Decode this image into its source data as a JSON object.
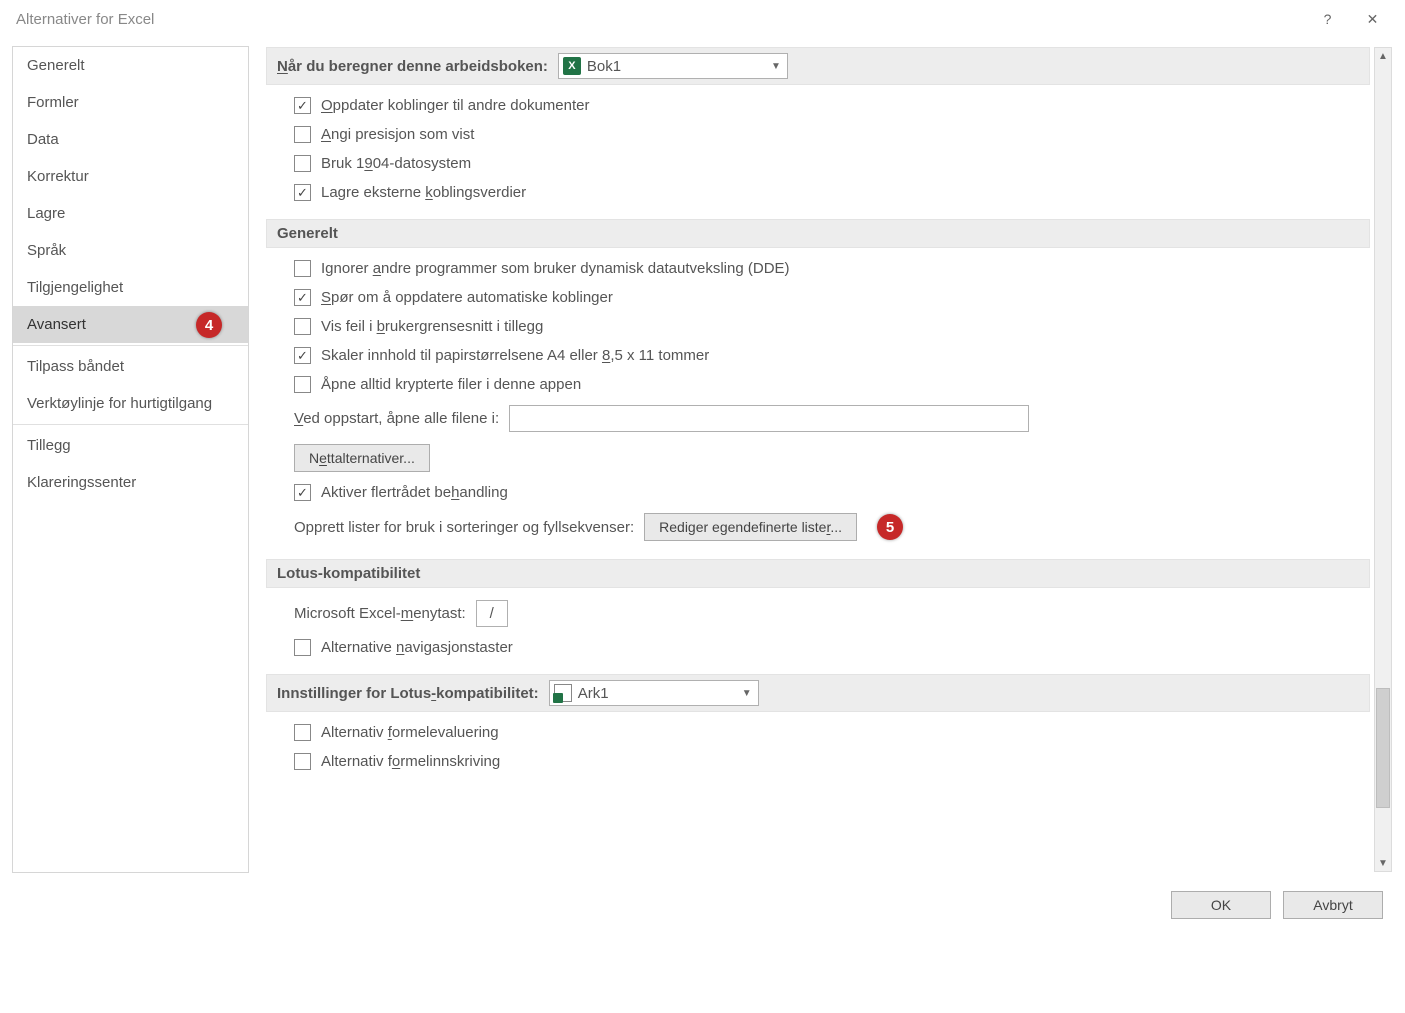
{
  "window": {
    "title": "Alternativer for Excel",
    "help": "?",
    "close": "✕"
  },
  "sidebar": {
    "items": [
      "Generelt",
      "Formler",
      "Data",
      "Korrektur",
      "Lagre",
      "Språk",
      "Tilgjengelighet",
      "Avansert",
      "Tilpass båndet",
      "Verktøylinje for hurtigtilgang",
      "Tillegg",
      "Klareringssenter"
    ],
    "selected_index": 7
  },
  "badges": {
    "sidebar": "4",
    "custom_lists": "5"
  },
  "section_calc": {
    "header_prefix": "N",
    "header_rest": "år du beregner denne arbeidsboken:",
    "combo_value": "Bok1",
    "opts": [
      {
        "checked": true,
        "pre": "",
        "u": "O",
        "post": "ppdater koblinger til andre dokumenter"
      },
      {
        "checked": false,
        "pre": "",
        "u": "A",
        "post": "ngi presisjon som vist"
      },
      {
        "checked": false,
        "pre": "Bruk 1",
        "u": "9",
        "post": "04-datosystem"
      },
      {
        "checked": true,
        "pre": "Lagre eksterne ",
        "u": "k",
        "post": "oblingsverdier"
      }
    ]
  },
  "section_general": {
    "header": "Generelt",
    "opts": [
      {
        "checked": false,
        "pre": "Ignorer ",
        "u": "a",
        "post": "ndre programmer som bruker dynamisk datautveksling (DDE)"
      },
      {
        "checked": true,
        "pre": "",
        "u": "S",
        "post": "pør om å oppdatere automatiske koblinger"
      },
      {
        "checked": false,
        "pre": "Vis feil i ",
        "u": "b",
        "post": "rukergrensesnitt i tillegg"
      },
      {
        "checked": true,
        "pre": "Skaler innhold til papirstørrelsene A4 eller ",
        "u": "8",
        "post": ",5 x 11 tommer"
      },
      {
        "checked": false,
        "pre": "Åpne alltid krypterte filer i denne appen",
        "u": "",
        "post": ""
      }
    ],
    "startup_label_pre": "",
    "startup_label_u": "V",
    "startup_label_post": "ed oppstart, åpne alle filene i:",
    "startup_value": "",
    "web_options_btn_pre": "N",
    "web_options_btn_u": "e",
    "web_options_btn_post": "ttalternativer...",
    "multithread": {
      "checked": true,
      "pre": "Aktiver flertrådet be",
      "u": "h",
      "post": "andling"
    },
    "lists_label": "Opprett lister for bruk i sorteringer og fyllsekvenser:",
    "lists_btn_pre": "Rediger egendefinerte liste",
    "lists_btn_u": "r",
    "lists_btn_post": "..."
  },
  "section_lotus": {
    "header": "Lotus-kompatibilitet",
    "menukey_label_pre": "Microsoft Excel-",
    "menukey_label_u": "m",
    "menukey_label_post": "enytast:",
    "menukey_value": "/",
    "altnav": {
      "checked": false,
      "pre": "Alternative ",
      "u": "n",
      "post": "avigasjonstaster"
    }
  },
  "section_lotus_settings": {
    "header_pre": "Innstillinger for Lotus",
    "header_u": "-",
    "header_post": "kompatibilitet:",
    "combo_value": "Ark1",
    "opts": [
      {
        "checked": false,
        "pre": "Alternativ ",
        "u": "f",
        "post": "ormelevaluering"
      },
      {
        "checked": false,
        "pre": "Alternativ f",
        "u": "o",
        "post": "rmelinnskriving"
      }
    ]
  },
  "footer": {
    "ok": "OK",
    "cancel": "Avbryt"
  }
}
